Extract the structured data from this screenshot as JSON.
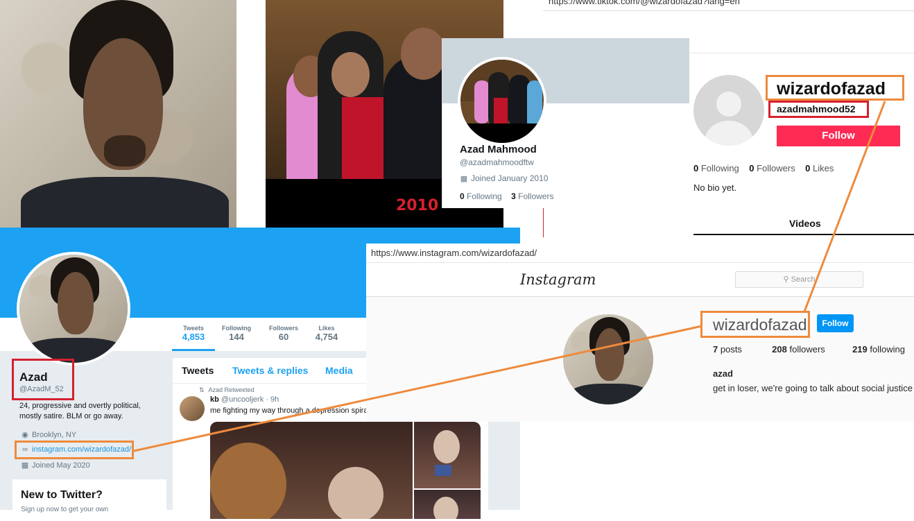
{
  "tiktok": {
    "url": "https://www.tiktok.com/@wizardofazad?lang=en",
    "username": "wizardofazad",
    "handle": "azadmahmood52",
    "follow_label": "Follow",
    "following_count": "0",
    "following_label": "Following",
    "followers_count": "0",
    "followers_label": "Followers",
    "likes_count": "0",
    "likes_label": "Likes",
    "bio": "No bio yet.",
    "videos_tab": "Videos"
  },
  "old_twitter": {
    "name": "Azad Mahmood",
    "handle": "@azadmahmoodftw",
    "joined": "Joined January 2010",
    "following_count": "0",
    "following_label": "Following",
    "followers_count": "3",
    "followers_label": "Followers"
  },
  "photo_2010": {
    "year": "2010"
  },
  "new_twitter": {
    "stats": [
      {
        "label": "Tweets",
        "value": "4,853"
      },
      {
        "label": "Following",
        "value": "144"
      },
      {
        "label": "Followers",
        "value": "60"
      },
      {
        "label": "Likes",
        "value": "4,754"
      }
    ],
    "name": "Azad",
    "handle": "@AzadM_52",
    "bio_line1": "24, progressive and overtly political,",
    "bio_line2": "mostly satire. BLM or go away.",
    "location": "Brooklyn, NY",
    "link": "instagram.com/wizardofazad/",
    "joined": "Joined May 2020",
    "new_to_twitter": "New to Twitter?",
    "signup_text": "Sign up now to get your own",
    "tabs": [
      "Tweets",
      "Tweets & replies",
      "Media"
    ],
    "retweeted_by": "Azad Retweeted",
    "tweet_author": "kb",
    "tweet_handle": "@uncooljerk",
    "tweet_time": "· 9h",
    "tweet_text": "me fighting my way through a depression spiral"
  },
  "instagram": {
    "url": "https://www.instagram.com/wizardofazad/",
    "logo": "Instagram",
    "search_placeholder": "Search",
    "username": "wizardofazad",
    "follow_label": "Follow",
    "posts": "7",
    "posts_label": "posts",
    "followers": "208",
    "followers_label": "followers",
    "following": "219",
    "following_label": "following",
    "name": "azad",
    "bio": "get in loser, we're going to talk about social justice"
  },
  "colors": {
    "orange": "#ee8a3c",
    "red": "#d6202f",
    "twitter_blue": "#1da1f2",
    "tiktok_red": "#fe2c55",
    "ig_blue": "#0095f6"
  }
}
